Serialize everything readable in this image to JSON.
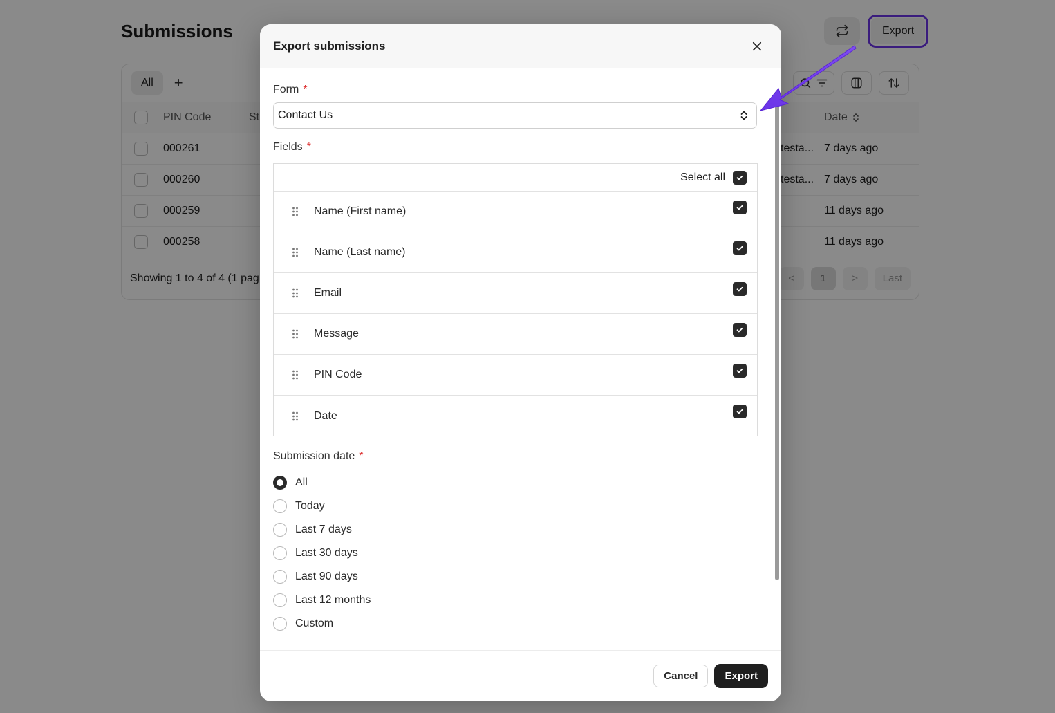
{
  "page": {
    "title": "Submissions",
    "export_label": "Export",
    "tabs": {
      "all": "All",
      "add": "+"
    },
    "columns": {
      "pin": "PIN Code",
      "status": "St",
      "date": "Date"
    },
    "rows": [
      {
        "pin": "000261",
        "email": "testa...",
        "date": "7 days ago"
      },
      {
        "pin": "000260",
        "email": "testa...",
        "date": "7 days ago"
      },
      {
        "pin": "000259",
        "email": "",
        "date": "11 days ago"
      },
      {
        "pin": "000258",
        "email": "",
        "date": "11 days ago"
      }
    ],
    "footer_text": "Showing 1 to 4 of 4 (1 pag",
    "pager": {
      "prev": "<",
      "current": "1",
      "next": ">",
      "last": "Last"
    }
  },
  "modal": {
    "title": "Export submissions",
    "form_label": "Form",
    "required_mark": "*",
    "form_value": "Contact Us",
    "fields_label": "Fields",
    "select_all_label": "Select all",
    "fields": [
      {
        "label": "Name (First name)",
        "checked": true
      },
      {
        "label": "Name (Last name)",
        "checked": true
      },
      {
        "label": "Email",
        "checked": true
      },
      {
        "label": "Message",
        "checked": true
      },
      {
        "label": "PIN Code",
        "checked": true
      },
      {
        "label": "Date",
        "checked": true
      }
    ],
    "submission_date_label": "Submission date",
    "date_options": [
      {
        "label": "All",
        "selected": true
      },
      {
        "label": "Today",
        "selected": false
      },
      {
        "label": "Last 7 days",
        "selected": false
      },
      {
        "label": "Last 30 days",
        "selected": false
      },
      {
        "label": "Last 90 days",
        "selected": false
      },
      {
        "label": "Last 12 months",
        "selected": false
      },
      {
        "label": "Custom",
        "selected": false
      }
    ],
    "cancel_label": "Cancel",
    "export_label": "Export"
  },
  "colors": {
    "annotation": "#6b34e8",
    "primary": "#1f1f1f",
    "required": "#dd3333"
  }
}
